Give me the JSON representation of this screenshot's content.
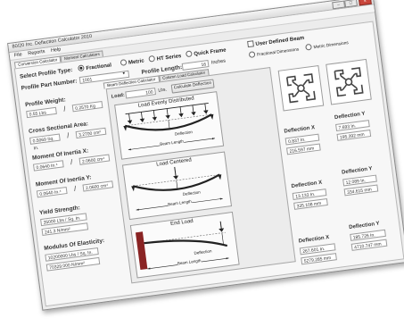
{
  "window": {
    "title": "80/20 Inc. Deflection Calculator 2010"
  },
  "menu": [
    "File",
    "Reports",
    "Help"
  ],
  "top_tabs": [
    "Conversion Calculator",
    "Moment Calculators"
  ],
  "profile_type": {
    "label": "Select Profile Type:",
    "options": [
      "Fractional",
      "Metric",
      "HT Series",
      "Quick Frame"
    ],
    "selected": "Fractional"
  },
  "user_defined": {
    "label": "User Defined Beam",
    "options": [
      "Fractional Dimensions",
      "Metric Dimensions"
    ]
  },
  "part_number": {
    "label": "Profile Part Number:",
    "value": "1001"
  },
  "profile_length": {
    "label": "Profile Length:",
    "value": "16",
    "unit": "Inches"
  },
  "properties": {
    "weight": {
      "label": "Profile Weight:",
      "imperial": "0.55 Lbs",
      "metric": "0.2570 Kg"
    },
    "area": {
      "label": "Cross Sectional Area:",
      "imperial": "0.5069 Sq. In.",
      "metric": "3.2700 cm²"
    },
    "inertia_x": {
      "label": "Moment Of Inertia X:",
      "imperial": "0.0640 In.⁴",
      "metric": "2.0600 cm⁴"
    },
    "inertia_y": {
      "label": "Moment Of Inertia Y:",
      "imperial": "0.0640 In.⁴",
      "metric": "2.0600 cm⁴"
    },
    "yield": {
      "label": "Yield Strength:",
      "imperial": "35000 Lbs / Sq. In.",
      "metric": "241.3 N/mm²"
    },
    "modulus": {
      "label": "Modulus Of Elasticity:",
      "imperial": "10200000 Lbs / Sq. In.",
      "metric": "70329.000 N/mm²"
    }
  },
  "calc_tabs": [
    "Beam Deflection Calculator",
    "Column Load Calculator"
  ],
  "load": {
    "label": "Load:",
    "value": "100",
    "unit": "Lbs.",
    "button": "Calculate Deflection"
  },
  "diagrams": [
    {
      "title": "Load Evenly Distributed",
      "deflection_label": "Deflection",
      "length_label": "Beam Length"
    },
    {
      "title": "Load Centered",
      "deflection_label": "Deflection",
      "length_label": "Beam Length"
    },
    {
      "title": "End Load",
      "deflection_label": "Deflection",
      "length_label": "Beam Length"
    }
  ],
  "results": [
    {
      "x_label": "Deflection X",
      "x_in": "0.837 In.",
      "x_mm": "216.597 mm",
      "y_label": "Deflection Y",
      "y_in": "7.693 In.",
      "y_mm": "195.392 mm"
    },
    {
      "x_label": "Deflection X",
      "x_in": "13.133 In.",
      "x_mm": "335.108 mm",
      "y_label": "Deflection Y",
      "y_in": "12.089 In.",
      "y_mm": "334.615 mm"
    },
    {
      "x_label": "Deflection X",
      "x_in": "267.601 In.",
      "x_mm": "5279.285 mm",
      "y_label": "Deflection Y",
      "y_in": "185.726 In.",
      "y_mm": "4710.747 mm"
    }
  ]
}
